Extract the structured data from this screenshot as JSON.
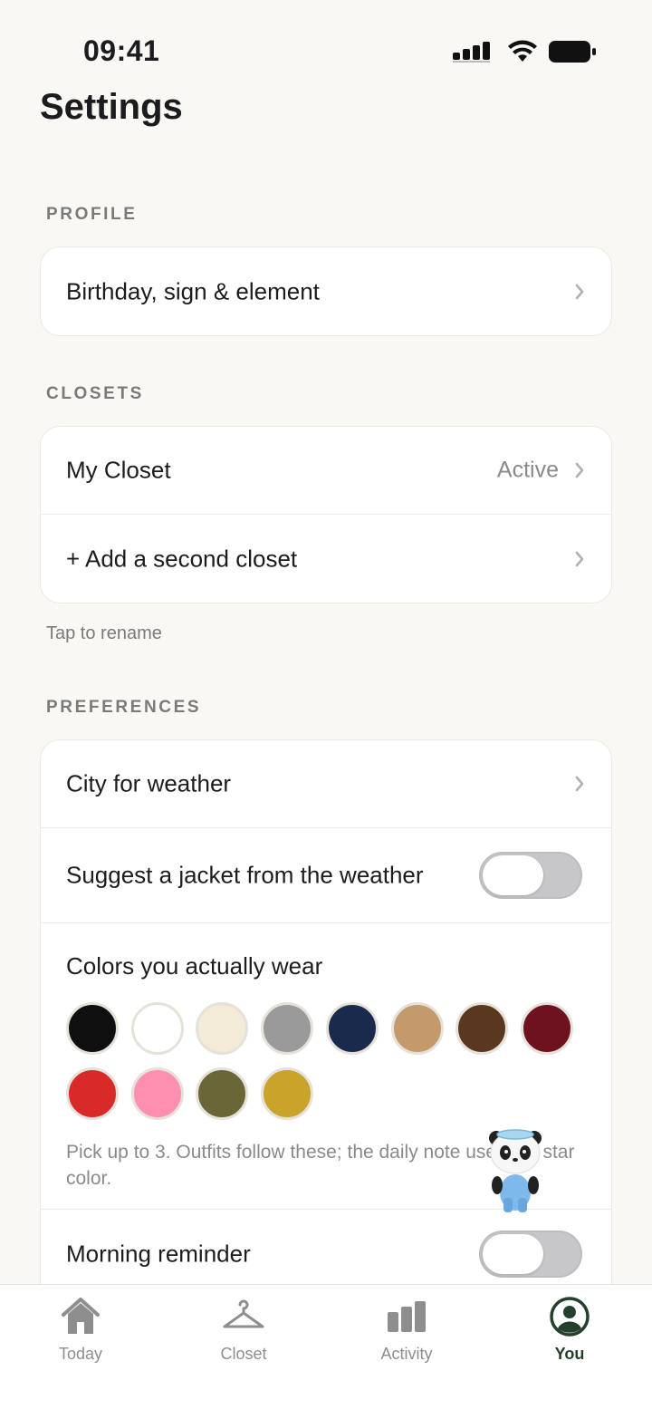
{
  "status_bar": {
    "time": "09:41"
  },
  "page_title": "Settings",
  "profile": {
    "section_label": "PROFILE",
    "rows": [
      {
        "label": "Birthday, sign & element"
      }
    ]
  },
  "closets": {
    "section_label": "CLOSETS",
    "rows": [
      {
        "label": "My Closet",
        "value": "Active"
      },
      {
        "label": "+ Add a second closet"
      }
    ],
    "hint": "Tap to rename"
  },
  "preferences": {
    "section_label": "PREFERENCES",
    "city_label": "City for weather",
    "jacket_label": "Suggest a jacket from the weather",
    "jacket_enabled": false,
    "colors_title": "Colors you actually wear",
    "swatch_colors": [
      "#0f0f10",
      "#ffffff",
      "#f3ead7",
      "#9a9a9a",
      "#1a2a4c",
      "#c49a6c",
      "#5a3820",
      "#6f1220",
      "#d92a2a",
      "#ff8fb0",
      "#6b6638",
      "#c9a32a"
    ],
    "colors_note": "Pick up to 3. Outfits follow these; the daily note uses the star color.",
    "reminder_label": "Morning reminder",
    "reminder_enabled": false
  },
  "tabbar": {
    "tabs": [
      {
        "label": "Today",
        "icon": "home-icon"
      },
      {
        "label": "Closet",
        "icon": "hanger-icon"
      },
      {
        "label": "Activity",
        "icon": "bar-chart-icon"
      },
      {
        "label": "You",
        "icon": "profile-icon"
      }
    ],
    "active_index": 3,
    "active_color": "#24402c",
    "inactive_color": "#8e8e8e"
  },
  "accent_colors": {
    "background": "#f9f8f4",
    "card": "#ffffff",
    "toggle_off": "#c7c7c9"
  }
}
